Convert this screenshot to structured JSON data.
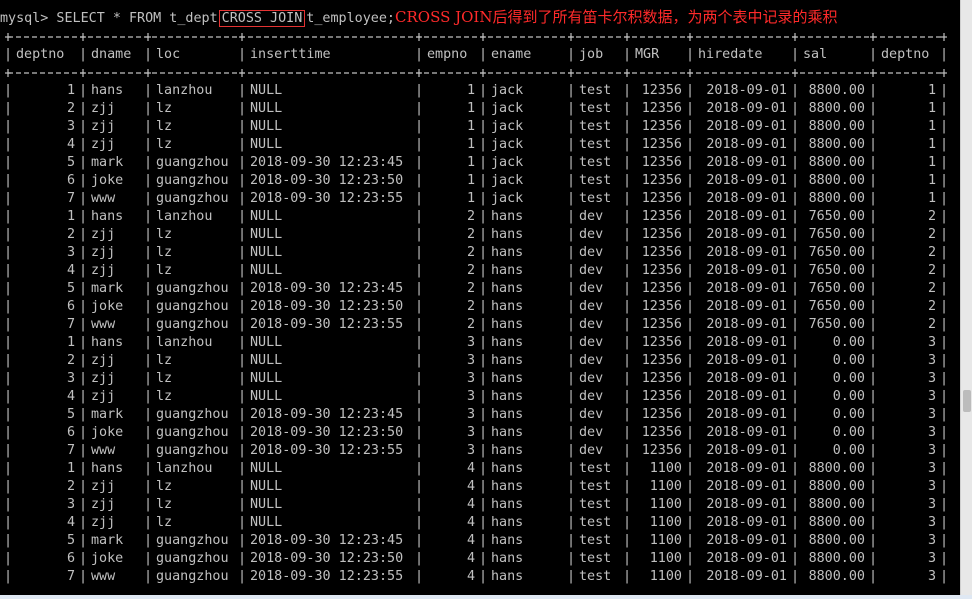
{
  "prompt": {
    "prefix": "mysql> SELECT * FROM t_dept",
    "keyword": "CROSS JOIN",
    "suffix": "t_employee;",
    "annotation": "CROSS JOIN后得到了所有笛卡尔积数据，为两个表中记录的乘积"
  },
  "table": {
    "columns": [
      "deptno",
      "dname",
      "loc",
      "inserttime",
      "empno",
      "ename",
      "job",
      "MGR",
      "hiredate",
      "sal",
      "deptno"
    ],
    "rows": [
      [
        "1",
        "hans",
        "lanzhou",
        "NULL",
        "1",
        "jack",
        "test",
        "12356",
        "2018-09-01",
        "8800.00",
        "1"
      ],
      [
        "2",
        "zjj",
        "lz",
        "NULL",
        "1",
        "jack",
        "test",
        "12356",
        "2018-09-01",
        "8800.00",
        "1"
      ],
      [
        "3",
        "zjj",
        "lz",
        "NULL",
        "1",
        "jack",
        "test",
        "12356",
        "2018-09-01",
        "8800.00",
        "1"
      ],
      [
        "4",
        "zjj",
        "lz",
        "NULL",
        "1",
        "jack",
        "test",
        "12356",
        "2018-09-01",
        "8800.00",
        "1"
      ],
      [
        "5",
        "mark",
        "guangzhou",
        "2018-09-30 12:23:45",
        "1",
        "jack",
        "test",
        "12356",
        "2018-09-01",
        "8800.00",
        "1"
      ],
      [
        "6",
        "joke",
        "guangzhou",
        "2018-09-30 12:23:50",
        "1",
        "jack",
        "test",
        "12356",
        "2018-09-01",
        "8800.00",
        "1"
      ],
      [
        "7",
        "www",
        "guangzhou",
        "2018-09-30 12:23:55",
        "1",
        "jack",
        "test",
        "12356",
        "2018-09-01",
        "8800.00",
        "1"
      ],
      [
        "1",
        "hans",
        "lanzhou",
        "NULL",
        "2",
        "hans",
        "dev",
        "12356",
        "2018-09-01",
        "7650.00",
        "2"
      ],
      [
        "2",
        "zjj",
        "lz",
        "NULL",
        "2",
        "hans",
        "dev",
        "12356",
        "2018-09-01",
        "7650.00",
        "2"
      ],
      [
        "3",
        "zjj",
        "lz",
        "NULL",
        "2",
        "hans",
        "dev",
        "12356",
        "2018-09-01",
        "7650.00",
        "2"
      ],
      [
        "4",
        "zjj",
        "lz",
        "NULL",
        "2",
        "hans",
        "dev",
        "12356",
        "2018-09-01",
        "7650.00",
        "2"
      ],
      [
        "5",
        "mark",
        "guangzhou",
        "2018-09-30 12:23:45",
        "2",
        "hans",
        "dev",
        "12356",
        "2018-09-01",
        "7650.00",
        "2"
      ],
      [
        "6",
        "joke",
        "guangzhou",
        "2018-09-30 12:23:50",
        "2",
        "hans",
        "dev",
        "12356",
        "2018-09-01",
        "7650.00",
        "2"
      ],
      [
        "7",
        "www",
        "guangzhou",
        "2018-09-30 12:23:55",
        "2",
        "hans",
        "dev",
        "12356",
        "2018-09-01",
        "7650.00",
        "2"
      ],
      [
        "1",
        "hans",
        "lanzhou",
        "NULL",
        "3",
        "hans",
        "dev",
        "12356",
        "2018-09-01",
        "0.00",
        "3"
      ],
      [
        "2",
        "zjj",
        "lz",
        "NULL",
        "3",
        "hans",
        "dev",
        "12356",
        "2018-09-01",
        "0.00",
        "3"
      ],
      [
        "3",
        "zjj",
        "lz",
        "NULL",
        "3",
        "hans",
        "dev",
        "12356",
        "2018-09-01",
        "0.00",
        "3"
      ],
      [
        "4",
        "zjj",
        "lz",
        "NULL",
        "3",
        "hans",
        "dev",
        "12356",
        "2018-09-01",
        "0.00",
        "3"
      ],
      [
        "5",
        "mark",
        "guangzhou",
        "2018-09-30 12:23:45",
        "3",
        "hans",
        "dev",
        "12356",
        "2018-09-01",
        "0.00",
        "3"
      ],
      [
        "6",
        "joke",
        "guangzhou",
        "2018-09-30 12:23:50",
        "3",
        "hans",
        "dev",
        "12356",
        "2018-09-01",
        "0.00",
        "3"
      ],
      [
        "7",
        "www",
        "guangzhou",
        "2018-09-30 12:23:55",
        "3",
        "hans",
        "dev",
        "12356",
        "2018-09-01",
        "0.00",
        "3"
      ],
      [
        "1",
        "hans",
        "lanzhou",
        "NULL",
        "4",
        "hans",
        "test",
        "1100",
        "2018-09-01",
        "8800.00",
        "3"
      ],
      [
        "2",
        "zjj",
        "lz",
        "NULL",
        "4",
        "hans",
        "test",
        "1100",
        "2018-09-01",
        "8800.00",
        "3"
      ],
      [
        "3",
        "zjj",
        "lz",
        "NULL",
        "4",
        "hans",
        "test",
        "1100",
        "2018-09-01",
        "8800.00",
        "3"
      ],
      [
        "4",
        "zjj",
        "lz",
        "NULL",
        "4",
        "hans",
        "test",
        "1100",
        "2018-09-01",
        "8800.00",
        "3"
      ],
      [
        "5",
        "mark",
        "guangzhou",
        "2018-09-30 12:23:45",
        "4",
        "hans",
        "test",
        "1100",
        "2018-09-01",
        "8800.00",
        "3"
      ],
      [
        "6",
        "joke",
        "guangzhou",
        "2018-09-30 12:23:50",
        "4",
        "hans",
        "test",
        "1100",
        "2018-09-01",
        "8800.00",
        "3"
      ],
      [
        "7",
        "www",
        "guangzhou",
        "2018-09-30 12:23:55",
        "4",
        "hans",
        "test",
        "1100",
        "2018-09-01",
        "8800.00",
        "3"
      ]
    ]
  }
}
